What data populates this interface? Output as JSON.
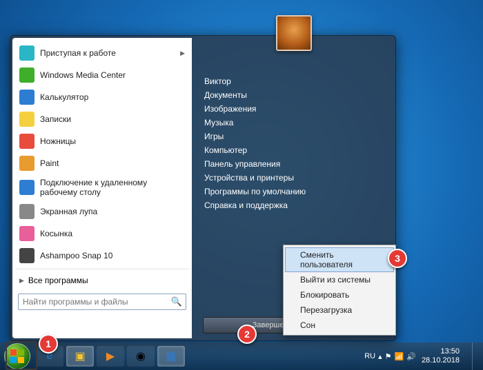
{
  "start_menu": {
    "left_items": [
      {
        "label": "Приступая к работе",
        "icon": "getting-started-icon",
        "cls": "ic-cyan",
        "arrow": true
      },
      {
        "label": "Windows Media Center",
        "icon": "wmc-icon",
        "cls": "ic-green"
      },
      {
        "label": "Калькулятор",
        "icon": "calculator-icon",
        "cls": "ic-blue"
      },
      {
        "label": "Записки",
        "icon": "notes-icon",
        "cls": "ic-yellow"
      },
      {
        "label": "Ножницы",
        "icon": "snipping-icon",
        "cls": "ic-red"
      },
      {
        "label": "Paint",
        "icon": "paint-icon",
        "cls": "ic-orange"
      },
      {
        "label": "Подключение к удаленному рабочему столу",
        "icon": "rdp-icon",
        "cls": "ic-blue"
      },
      {
        "label": "Экранная лупа",
        "icon": "magnifier-icon",
        "cls": "ic-grey"
      },
      {
        "label": "Косынка",
        "icon": "solitaire-icon",
        "cls": "ic-pink"
      },
      {
        "label": "Ashampoo Snap 10",
        "icon": "ashampoo-icon",
        "cls": "ic-dark"
      }
    ],
    "all_programs": "Все программы",
    "search_placeholder": "Найти программы и файлы",
    "right_links": [
      "Виктор",
      "Документы",
      "Изображения",
      "Музыка",
      "Игры",
      "Компьютер",
      "Панель управления",
      "Устройства и принтеры",
      "Программы по умолчанию",
      "Справка и поддержка"
    ],
    "shutdown_label": "Завершение работы"
  },
  "shutdown_menu": {
    "items": [
      {
        "label": "Сменить пользователя",
        "highlight": true
      },
      {
        "label": "Выйти из системы"
      },
      {
        "label": "Блокировать"
      },
      {
        "label": "Перезагрузка"
      },
      {
        "label": "Сон"
      }
    ]
  },
  "taskbar": {
    "lang": "RU",
    "time": "13:50",
    "date": "28.10.2018"
  },
  "annotations": {
    "b1": "1",
    "b2": "2",
    "b3": "3"
  }
}
